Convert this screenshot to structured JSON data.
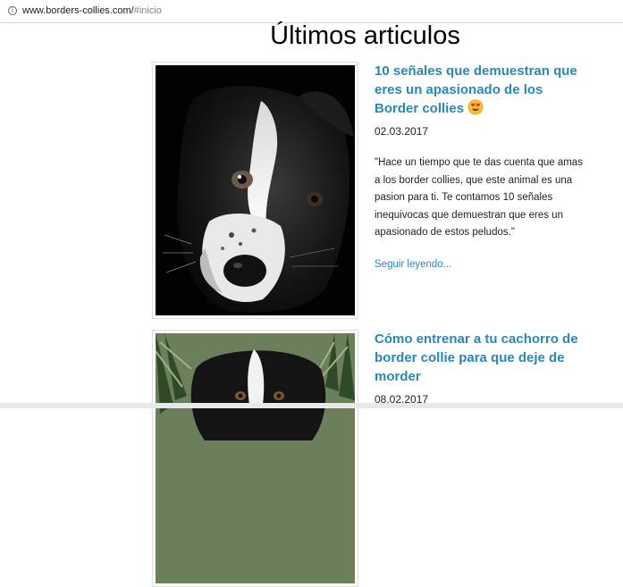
{
  "browser": {
    "url_host": "www.borders-collies.com/",
    "url_path": "#inicio",
    "info_icon": "info-icon"
  },
  "page": {
    "title": "Últimos articulos"
  },
  "articles": [
    {
      "title": "10 señales que demuestran que eres un apasionado de los Border collies",
      "emoji": "heart-eyes-emoji",
      "date": "02.03.2017",
      "excerpt": "\"Hace un tiempo que te das cuenta que amas a los border collies, que este animal es una pasion para ti. Te contamos 10 señales inequivocas que demuestran que eres un apasionado de estos peludos.\"",
      "read_more": "Seguir leyendo..."
    },
    {
      "title": "Cómo entrenar a tu cachorro de border collie para que deje de morder",
      "date": "08.02.2017"
    }
  ],
  "colors": {
    "link": "#2a88b8",
    "text": "#222222"
  }
}
